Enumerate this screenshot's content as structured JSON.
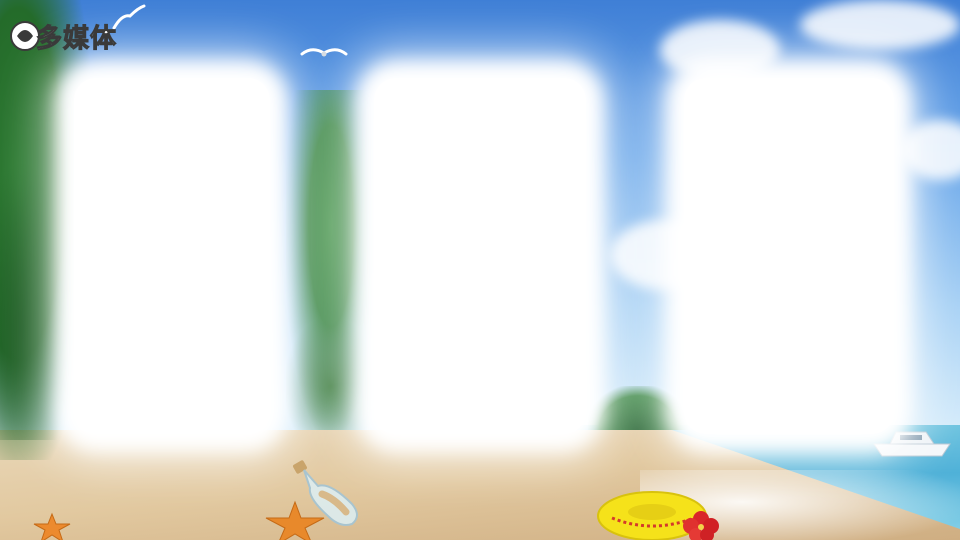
{
  "watermark": {
    "text": "多媒体"
  },
  "palette": {
    "sky_top": "#3f7fd6",
    "sky_bottom": "#d9eefb",
    "sea": "#4fb1d8",
    "sand": "#e2c9a0",
    "panel": "#ffffff",
    "foliage": "#2f7d34",
    "ring": "#f5e21a",
    "starfish": "#e8892b",
    "flower": "#d9262a"
  },
  "panels": [
    {
      "id": "left",
      "content": ""
    },
    {
      "id": "center",
      "content": ""
    },
    {
      "id": "right",
      "content": ""
    }
  ],
  "elements": [
    "seagull-icon",
    "palm-tree",
    "island",
    "message-bottle",
    "starfish-icon",
    "swim-ring",
    "hibiscus-flower",
    "boat"
  ]
}
